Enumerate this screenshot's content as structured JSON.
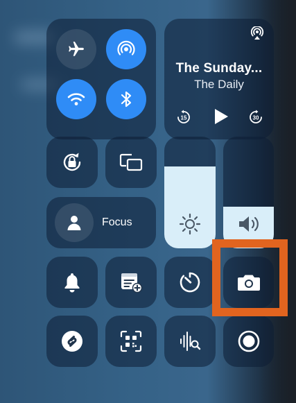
{
  "now_playing": {
    "title": "The Sunday...",
    "subtitle": "The Daily",
    "skip_back_seconds": "15",
    "skip_forward_seconds": "30"
  },
  "focus": {
    "label": "Focus"
  },
  "brightness": {
    "level": 0.73
  },
  "volume": {
    "level": 0.37
  },
  "colors": {
    "accent_blue": "#2f8cf6",
    "highlight_orange": "#e1641f",
    "slider_fill": "#d9eef9"
  },
  "icons": [
    "airplane-icon",
    "airdrop-icon",
    "wifi-icon",
    "bluetooth-icon",
    "airplay-icon",
    "rewind-15-icon",
    "play-icon",
    "forward-30-icon",
    "rotation-lock-icon",
    "screen-mirroring-icon",
    "person-icon",
    "brightness-icon",
    "volume-icon",
    "bell-icon",
    "notes-add-icon",
    "timer-icon",
    "camera-icon",
    "shazam-icon",
    "qr-code-icon",
    "sound-recognition-icon",
    "screen-record-icon"
  ]
}
